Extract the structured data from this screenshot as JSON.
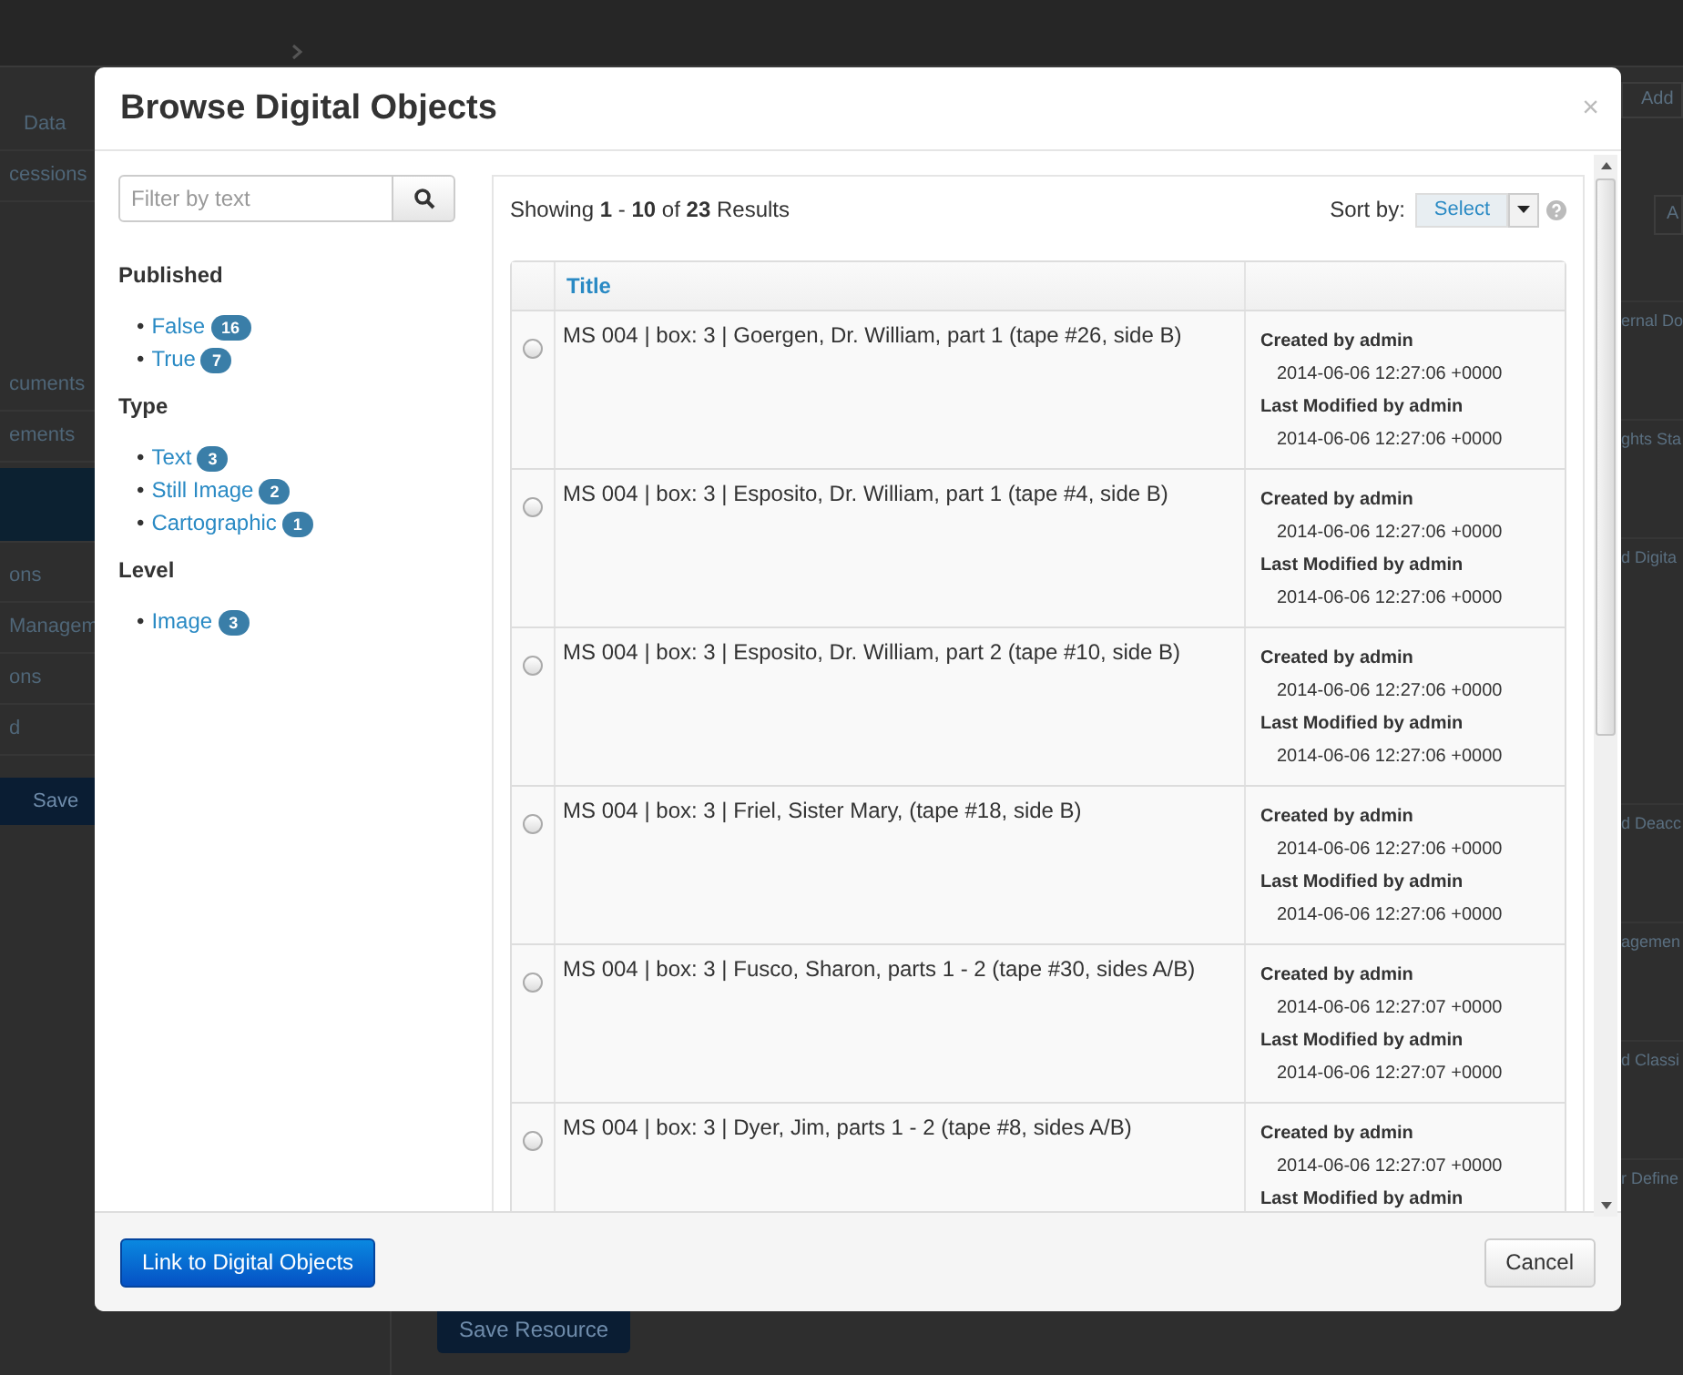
{
  "background_page": {
    "left_nav": [
      {
        "label": "Data",
        "selected": false
      },
      {
        "label": "cessions",
        "selected": false
      },
      {
        "label": "cuments",
        "selected": false
      },
      {
        "label": "ements",
        "selected": false
      },
      {
        "selected": true
      },
      {
        "label": "ons",
        "selected": false
      },
      {
        "label": "Managem",
        "selected": false
      },
      {
        "label": "ons",
        "selected": false
      },
      {
        "label": "d",
        "selected": false
      }
    ],
    "left_button": "Save",
    "right_buttons": [
      "Add",
      "A"
    ],
    "right_items": [
      "ernal Do",
      "ghts Sta",
      "d Digita",
      "d Deacc",
      "agemen",
      "d Classi",
      "r Define"
    ],
    "save_button": "Save Resource"
  },
  "modal": {
    "title": "Browse Digital Objects",
    "close": "×",
    "filter": {
      "placeholder": "Filter by text"
    },
    "facets": [
      {
        "heading": "Published",
        "items": [
          {
            "bullet": "•",
            "label": "False",
            "count": "16"
          },
          {
            "bullet": "•",
            "label": "True",
            "count": "7"
          }
        ]
      },
      {
        "heading": "Type",
        "items": [
          {
            "bullet": "•",
            "label": "Text",
            "count": "3"
          },
          {
            "bullet": "•",
            "label": "Still Image",
            "count": "2"
          },
          {
            "bullet": "•",
            "label": "Cartographic",
            "count": "1"
          }
        ]
      },
      {
        "heading": "Level",
        "items": [
          {
            "bullet": "•",
            "label": "Image",
            "count": "3"
          }
        ]
      }
    ],
    "summary": "Showing **1** - **10** of **23** Results",
    "sort_label": "Sort by:",
    "sort_button": "Select",
    "table": {
      "columns": [
        "Title"
      ],
      "rows": [
        {
          "selected": false,
          "title": "MS 004 | box: 3 | Goergen, Dr. William, part 1 (tape #26, side B)",
          "created": "Created by admin",
          "created_at": "2014-06-06 12:27:06 +0000",
          "modified": "Last Modified by admin",
          "modified_at": "2014-06-06 12:27:06 +0000"
        },
        {
          "selected": false,
          "title": "MS 004 | box: 3 | Esposito, Dr. William, part 1 (tape #4, side B)",
          "created": "Created by admin",
          "created_at": "2014-06-06 12:27:06 +0000",
          "modified": "Last Modified by admin",
          "modified_at": "2014-06-06 12:27:06 +0000"
        },
        {
          "selected": false,
          "title": "MS 004 | box: 3 | Esposito, Dr. William, part 2 (tape #10, side B)",
          "created": "Created by admin",
          "created_at": "2014-06-06 12:27:06 +0000",
          "modified": "Last Modified by admin",
          "modified_at": "2014-06-06 12:27:06 +0000"
        },
        {
          "selected": false,
          "title": "MS 004 | box: 3 | Friel, Sister Mary, (tape #18, side B)",
          "created": "Created by admin",
          "created_at": "2014-06-06 12:27:06 +0000",
          "modified": "Last Modified by admin",
          "modified_at": "2014-06-06 12:27:06 +0000"
        },
        {
          "selected": false,
          "title": "MS 004 | box: 3 | Fusco, Sharon, parts 1 - 2 (tape #30, sides A/B)",
          "created": "Created by admin",
          "created_at": "2014-06-06 12:27:07 +0000",
          "modified": "Last Modified by admin",
          "modified_at": "2014-06-06 12:27:07 +0000"
        },
        {
          "selected": false,
          "title": "MS 004 | box: 3 | Dyer, Jim, parts 1 - 2 (tape #8, sides A/B)",
          "created": "Created by admin",
          "created_at": "2014-06-06 12:27:07 +0000",
          "modified": "Last Modified by admin"
        }
      ]
    },
    "link_button": "Link to Digital Objects",
    "cancel_button": "Cancel"
  }
}
